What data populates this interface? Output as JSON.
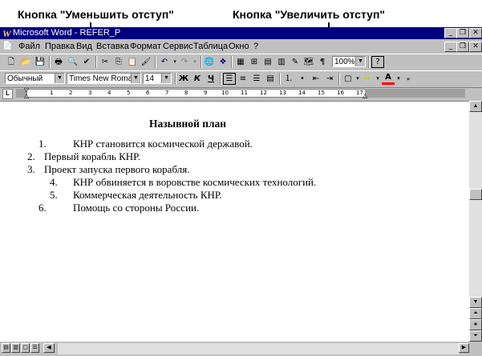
{
  "callouts": {
    "decrease": "Кнопка \"Уменьшить отступ\"",
    "increase": "Кнопка \"Увеличить  отступ\""
  },
  "window": {
    "title": "Microsoft Word - REFER_P",
    "app_icon": "W"
  },
  "menu": {
    "items": [
      "Файл",
      "Правка",
      "Вид",
      "Вставка",
      "Формат",
      "Сервис",
      "Таблица",
      "Окно",
      "?"
    ]
  },
  "standard_toolbar": {
    "zoom": "100%"
  },
  "format_toolbar": {
    "style": "Обычный",
    "font": "Times New Roman",
    "size": "14",
    "bold": "Ж",
    "italic": "К",
    "underline": "Ч"
  },
  "ruler": {
    "numbers": [
      "1",
      "2",
      "3",
      "4",
      "5",
      "6",
      "7",
      "8",
      "9",
      "10",
      "11",
      "12",
      "13",
      "14",
      "15",
      "16",
      "17"
    ]
  },
  "document": {
    "heading": "Назывной план",
    "lines": [
      {
        "num": "1.",
        "text": "КНР становится космической державой."
      },
      {
        "num": "2.",
        "text": "Первый корабль КНР."
      },
      {
        "num": "3.",
        "text": "Проект запуска первого корабля."
      },
      {
        "num": "4.",
        "text": "КНР обвиняется в воровстве космических технологий."
      },
      {
        "num": "5.",
        "text": "Коммерческая деятельность КНР."
      },
      {
        "num": "6.",
        "text": "Помощь со стороны России."
      }
    ]
  },
  "colors": {
    "title_bar": "#000080",
    "chrome": "#c0c0c0",
    "page": "#ffffff"
  }
}
